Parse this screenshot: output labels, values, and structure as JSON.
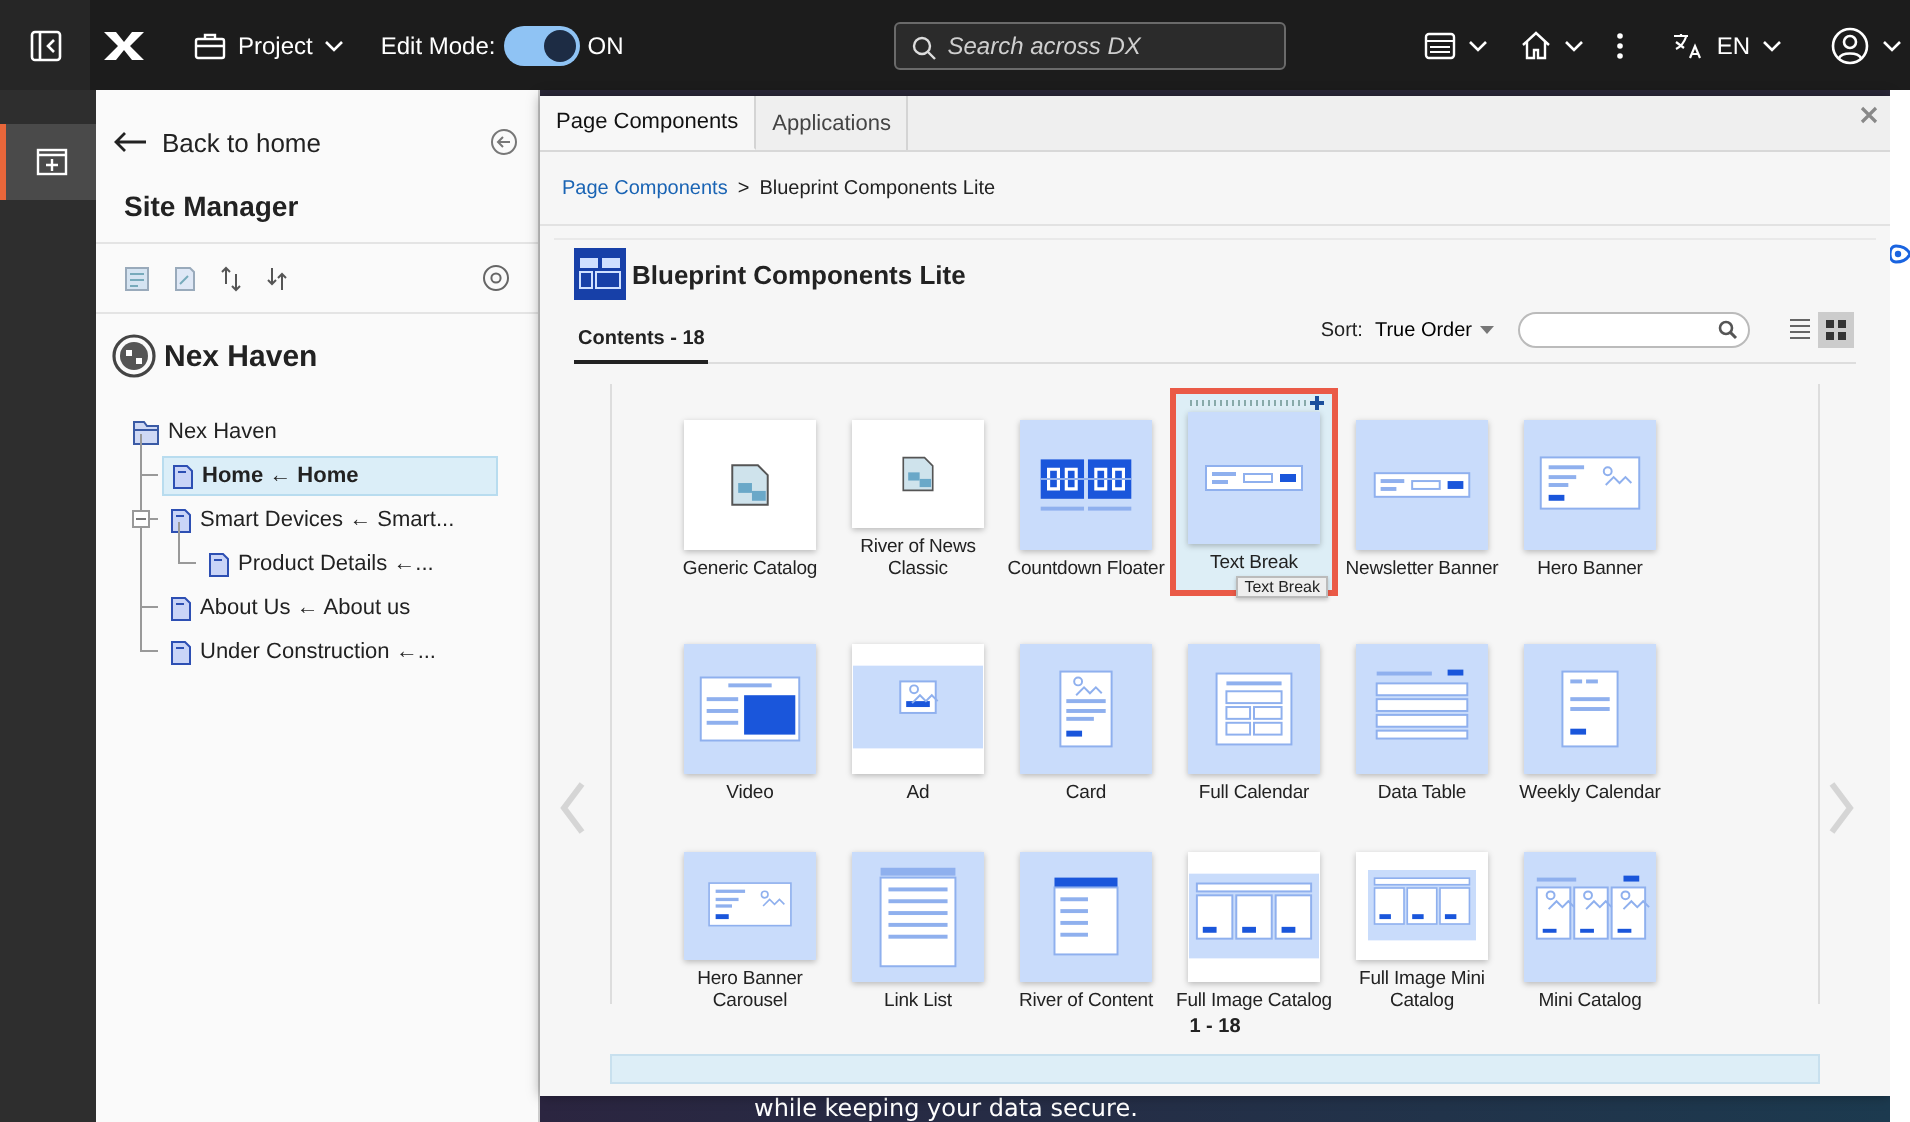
{
  "topbar": {
    "project": "Project",
    "edit_mode": {
      "label": "Edit Mode:",
      "on": true,
      "state_text": "ON"
    },
    "search": {
      "placeholder": "Search across DX"
    },
    "language": "EN"
  },
  "sidebar": {
    "back": "Back to home",
    "title": "Site Manager",
    "site_name": "Nex Haven",
    "tree": [
      {
        "label": "Nex Haven",
        "selected": false,
        "expanded": true,
        "children": [
          {
            "label": "Home ← Home",
            "selected": true
          },
          {
            "label": "Smart Devices ← Smart...",
            "selected": false,
            "expanded": true,
            "children": [
              {
                "label": "Product Details ←...",
                "selected": false
              }
            ]
          },
          {
            "label": "About Us ← About us",
            "selected": false
          },
          {
            "label": "Under Construction ←...",
            "selected": false
          }
        ]
      }
    ]
  },
  "modal": {
    "tabs": [
      {
        "label": "Page Components",
        "selected": true
      },
      {
        "label": "Applications",
        "selected": false
      }
    ],
    "breadcrumb": {
      "link": "Page Components",
      "separator": ">",
      "current": "Blueprint Components Lite"
    },
    "heading": "Blueprint Components Lite",
    "contents_tab": "Contents - 18",
    "sort": {
      "label": "Sort:",
      "value": "True Order"
    },
    "views": [
      {
        "kind": "list",
        "selected": false
      },
      {
        "kind": "grid",
        "selected": true
      }
    ],
    "tiles": [
      {
        "label": "Generic Catalog",
        "kind": "document",
        "selected": false
      },
      {
        "label": "River of News Classic",
        "kind": "document",
        "selected": false
      },
      {
        "label": "Countdown Floater",
        "kind": "countdown",
        "selected": false
      },
      {
        "label": "Text Break",
        "kind": "text-break",
        "selected": true,
        "tooltip": "Text Break"
      },
      {
        "label": "Newsletter Banner",
        "kind": "text-break",
        "selected": false
      },
      {
        "label": "Hero Banner",
        "kind": "hero",
        "selected": false
      },
      {
        "label": "Video",
        "kind": "video",
        "selected": false
      },
      {
        "label": "Ad",
        "kind": "ad",
        "selected": false
      },
      {
        "label": "Card",
        "kind": "card",
        "selected": false
      },
      {
        "label": "Full Calendar",
        "kind": "calendar",
        "selected": false
      },
      {
        "label": "Data Table",
        "kind": "table",
        "selected": false
      },
      {
        "label": "Weekly Calendar",
        "kind": "weekly",
        "selected": false
      },
      {
        "label": "Hero Banner Carousel",
        "kind": "hero",
        "selected": false
      },
      {
        "label": "Link List",
        "kind": "link-list",
        "selected": false
      },
      {
        "label": "River of Content",
        "kind": "river",
        "selected": false
      },
      {
        "label": "Full Image Catalog",
        "kind": "catalog-band",
        "selected": false
      },
      {
        "label": "Full Image Mini Catalog",
        "kind": "catalog-band",
        "selected": false
      },
      {
        "label": "Mini Catalog",
        "kind": "catalog",
        "selected": false
      }
    ],
    "pagination": "1 - 18"
  },
  "background_page": {
    "text": "while keeping your data secure."
  }
}
